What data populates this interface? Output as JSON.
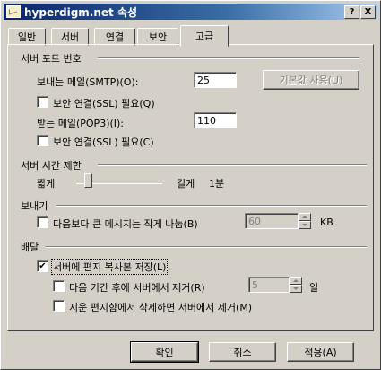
{
  "window": {
    "title": "hyperdigm.net 속성",
    "help_btn": "?",
    "close_btn": "X"
  },
  "tabs": [
    {
      "label": "일반",
      "active": false
    },
    {
      "label": "서버",
      "active": false
    },
    {
      "label": "연결",
      "active": false
    },
    {
      "label": "보안",
      "active": false
    },
    {
      "label": "고급",
      "active": true
    }
  ],
  "server_ports": {
    "title": "서버 포트 번호",
    "smtp_label": "보내는 메일(SMTP)(O):",
    "smtp_value": "25",
    "default_btn": "기본값 사용(U)",
    "smtp_ssl_label": "보안 연결(SSL) 필요(Q)",
    "smtp_ssl_checked": false,
    "pop3_label": "받는 메일(POP3)(I):",
    "pop3_value": "110",
    "pop3_ssl_label": "보안 연결(SSL) 필요(C)",
    "pop3_ssl_checked": false
  },
  "timeout": {
    "title": "서버 시간 제한",
    "short_label": "짧게",
    "long_label": "길게",
    "value_text": "1분",
    "slider_position": 0.1
  },
  "sending": {
    "title": "보내기",
    "split_label": "다음보다 큰 메시지는 작게 나눔(B)",
    "split_checked": false,
    "split_value": "60",
    "split_unit": "KB"
  },
  "delivery": {
    "title": "배달",
    "keep_copy_label": "서버에 편지 복사본 저장(L)",
    "keep_copy_checked": true,
    "remove_after_label": "다음 기간 후에 서버에서 제거(R)",
    "remove_after_checked": false,
    "remove_after_value": "5",
    "remove_after_unit": "일",
    "remove_deleted_label": "지운 편지함에서 삭제하면 서버에서 제거(M)",
    "remove_deleted_checked": false
  },
  "buttons": {
    "ok": "확인",
    "cancel": "취소",
    "apply": "적용(A)"
  }
}
